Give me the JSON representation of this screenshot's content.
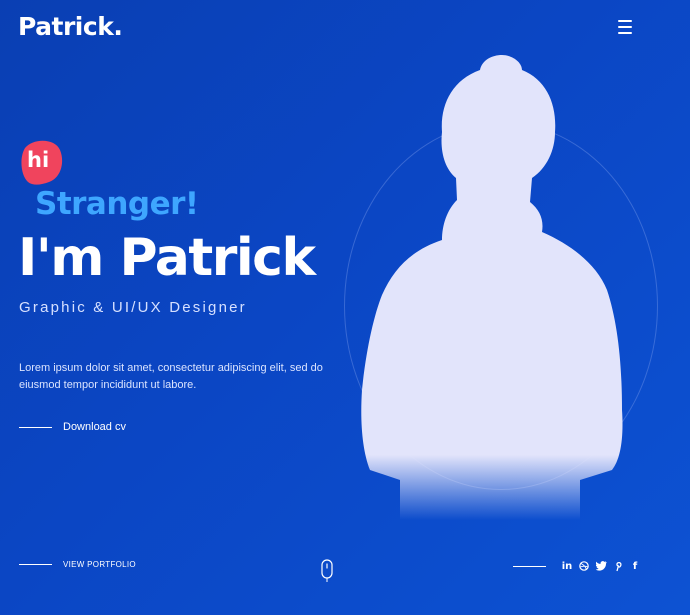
{
  "header": {
    "logo": "Patrick."
  },
  "hero": {
    "badge": "hi",
    "greeting": "Stranger!",
    "title": "I'm Patrick",
    "subtitle": "Graphic & UI/UX Designer",
    "intro": "Lorem ipsum dolor sit amet, consectetur adipiscing elit, sed do eiusmod tempor incididunt ut labore.",
    "cta": "Download cv"
  },
  "footer": {
    "portfolio_link": "VIEW PORTFOLIO",
    "social": [
      {
        "label": "in",
        "icon": "linkedin-icon"
      },
      {
        "label": "",
        "icon": "dribbble-icon"
      },
      {
        "label": "",
        "icon": "twitter-icon"
      },
      {
        "label": "",
        "icon": "pinterest-icon"
      },
      {
        "label": "f",
        "icon": "facebook-icon"
      }
    ]
  },
  "colors": {
    "background": "#0b46c4",
    "accent": "#3ea6ff",
    "badge": "#f0445d",
    "silhouette": "#e2e4fb"
  }
}
